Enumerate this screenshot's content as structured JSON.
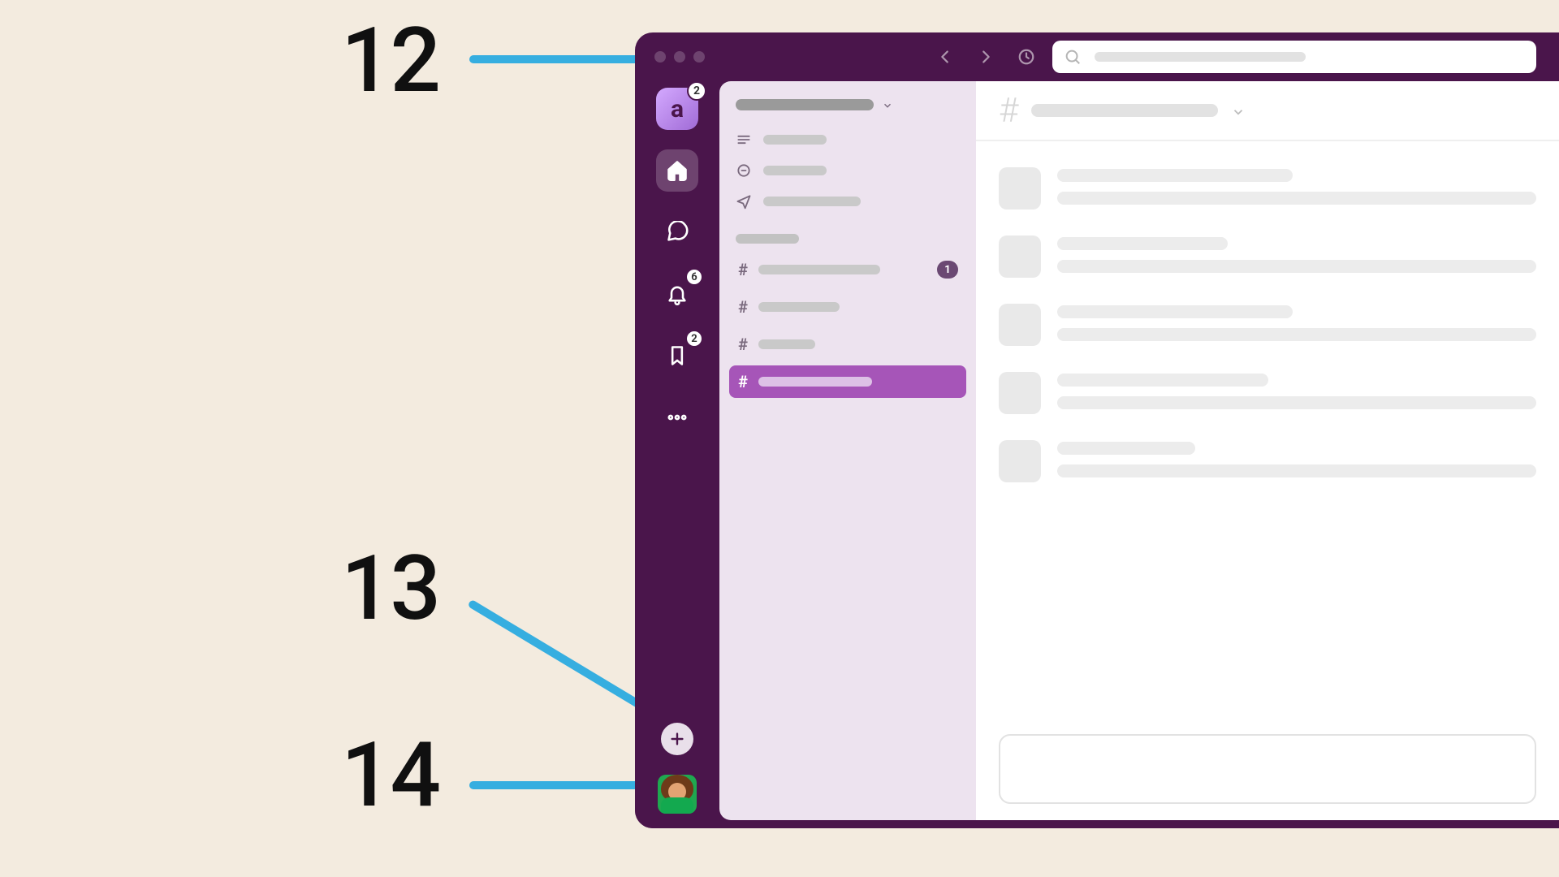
{
  "annotations": {
    "n12": "12",
    "n13": "13",
    "n14": "14"
  },
  "rail": {
    "workspace_letter": "a",
    "workspace_badge": "2",
    "activity_badge": "6",
    "later_badge": "2"
  },
  "sidebar": {
    "channels_unread_badge": "1"
  },
  "search": {
    "placeholder": ""
  }
}
